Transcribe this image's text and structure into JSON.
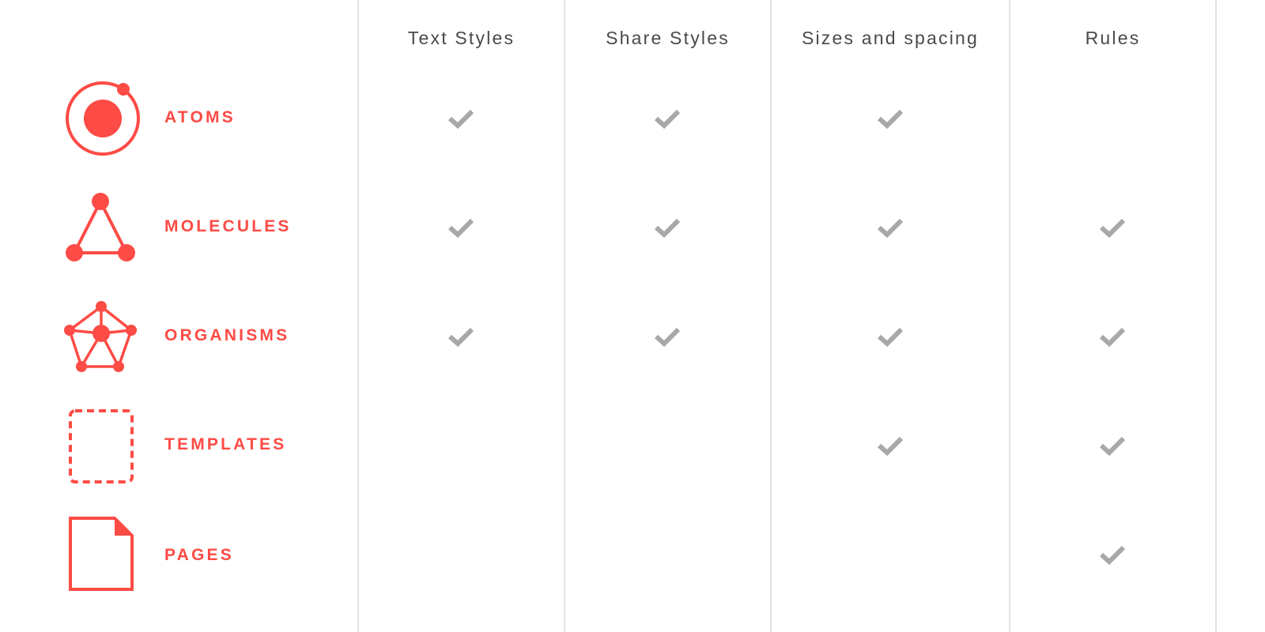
{
  "colors": {
    "accent": "#fd4b45",
    "check": "#a8a8a8",
    "header_text": "#4a4a4a",
    "divider": "#e2e2e2"
  },
  "columns": [
    {
      "label": "Text Styles"
    },
    {
      "label": "Share Styles"
    },
    {
      "label": "Sizes and spacing"
    },
    {
      "label": "Rules"
    }
  ],
  "rows": [
    {
      "label": "ATOMS",
      "icon": "atom-icon",
      "checks": [
        true,
        true,
        true,
        false
      ]
    },
    {
      "label": "MOLECULES",
      "icon": "molecule-icon",
      "checks": [
        true,
        true,
        true,
        true
      ]
    },
    {
      "label": "ORGANISMS",
      "icon": "organism-icon",
      "checks": [
        true,
        true,
        true,
        true
      ]
    },
    {
      "label": "TEMPLATES",
      "icon": "template-icon",
      "checks": [
        false,
        false,
        true,
        true
      ]
    },
    {
      "label": "PAGES",
      "icon": "page-icon",
      "checks": [
        false,
        false,
        false,
        true
      ]
    }
  ]
}
